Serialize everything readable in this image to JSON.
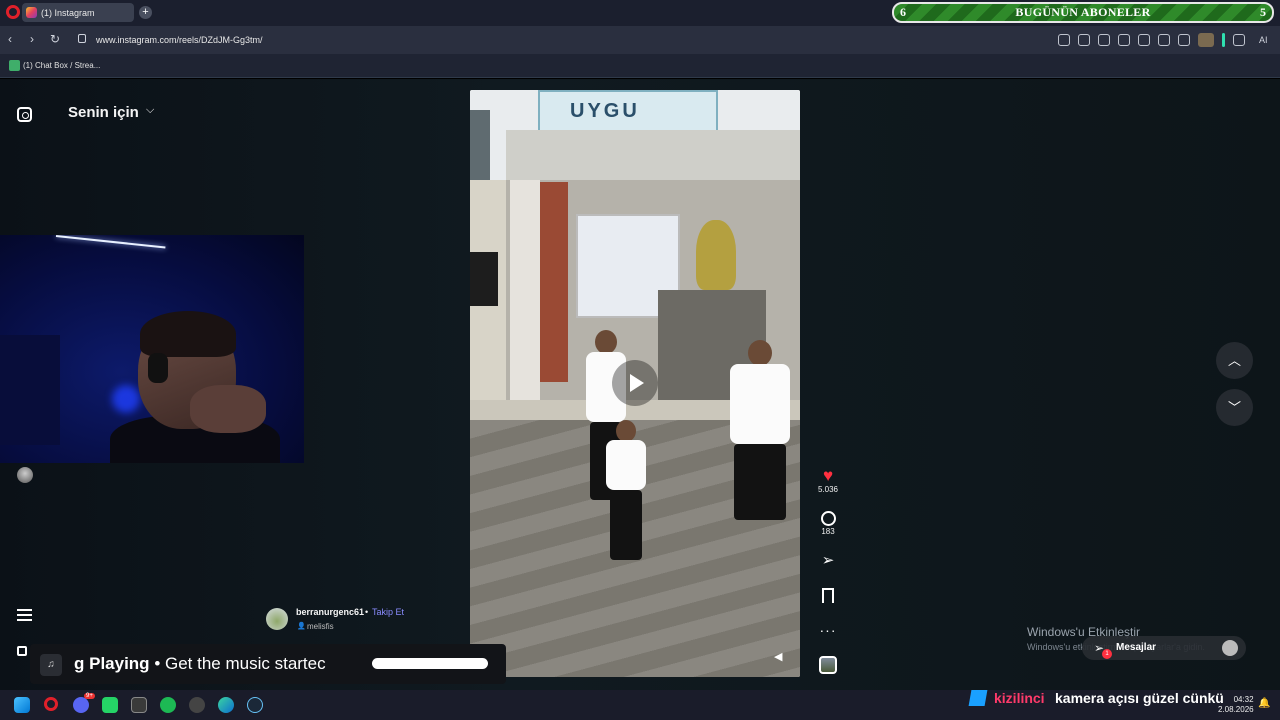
{
  "browser": {
    "tab_title": "(1) Instagram",
    "url": "www.instagram.com/reels/DZdJM-Gg3tm/",
    "bookmark": "(1) Chat Box / Strea...",
    "ai_label": "AI"
  },
  "subscriber_banner": {
    "title": "BUGÜNÜN ABONELER",
    "left_number": "6",
    "right_number": "5"
  },
  "instagram": {
    "feed_title": "Senin için",
    "video_sign_text": "UYGU",
    "likes": "5.036",
    "comments": "183",
    "creator": "berranurgenc61",
    "separator": "•",
    "follow_label": "Takip Et",
    "collaborator": "melisfis",
    "messages_label": "Mesajlar",
    "messages_badge": "1"
  },
  "now_playing": {
    "prefix": "g Playing",
    "separator": "•",
    "text": "Get the music startec"
  },
  "windows_activation": {
    "title": "Windows'u Etkinleştir",
    "subtitle": "Windows'u etkinleştirmek için Ayarlar'a gidin."
  },
  "taskbar": {
    "discord_badge": "9+",
    "ticker_user": "kizilinci",
    "ticker_message": "kamera açısı güzel cünkü",
    "time": "04:32",
    "date": "2.08.2026"
  },
  "colors": {
    "like_red": "#ff3040",
    "follow_blue": "#8a8cff",
    "banner_green": "#2f8a2a"
  }
}
